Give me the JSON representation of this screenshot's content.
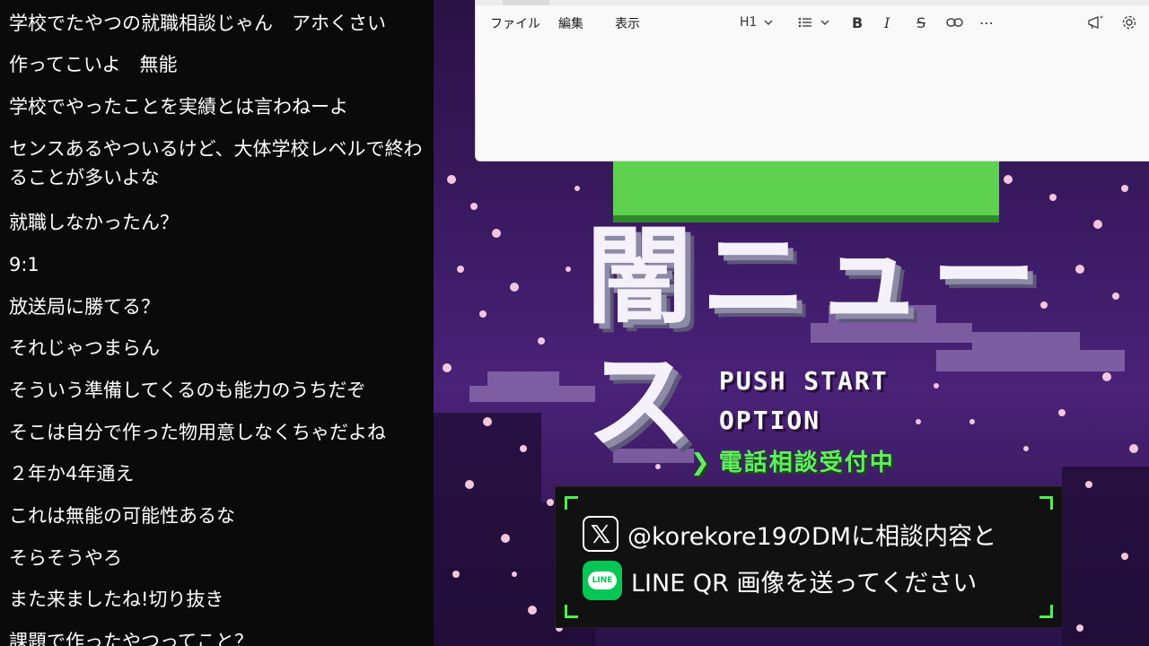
{
  "chat": {
    "messages": [
      "学校でたやつの就職相談じゃん　アホくさい",
      "作ってこいよ　無能",
      "学校でやったことを実績とは言わねーよ",
      "センスあるやついるけど、大体学校レベルで終わることが多いよな",
      "就職しなかったん？",
      "9:1",
      "放送局に勝てる？",
      "それじゃつまらん",
      "そういう準備してくるのも能力のうちだぞ",
      "そこは自分で作った物用意しなくちゃだよね",
      "２年か4年通え",
      "これは無能の可能性あるな",
      "そらそうやろ",
      "また来ましたね!切り抜き",
      "課題で作ったやつってこと？"
    ]
  },
  "editor": {
    "menu": [
      "ファイル",
      "編集",
      "表示"
    ],
    "heading_select": "H1",
    "toolbar_icons": [
      "list-icon",
      "bold-icon",
      "italic-icon",
      "strikethrough-icon",
      "link-icon",
      "more-icon",
      "megaphone-icon",
      "gear-icon"
    ]
  },
  "scene": {
    "title": "闇ニュース",
    "menu_items": [
      "PUSH START",
      "OPTION"
    ],
    "phone_line": "電話相談受付中",
    "info_x": "@korekore19のDMに相談内容と",
    "info_line": "LINE QR 画像を送ってください",
    "line_icon_text": "LINE",
    "colors": {
      "accent_green": "#5ef25a",
      "sky": "#3b1a63",
      "blossom": "#f3c6dc"
    }
  }
}
